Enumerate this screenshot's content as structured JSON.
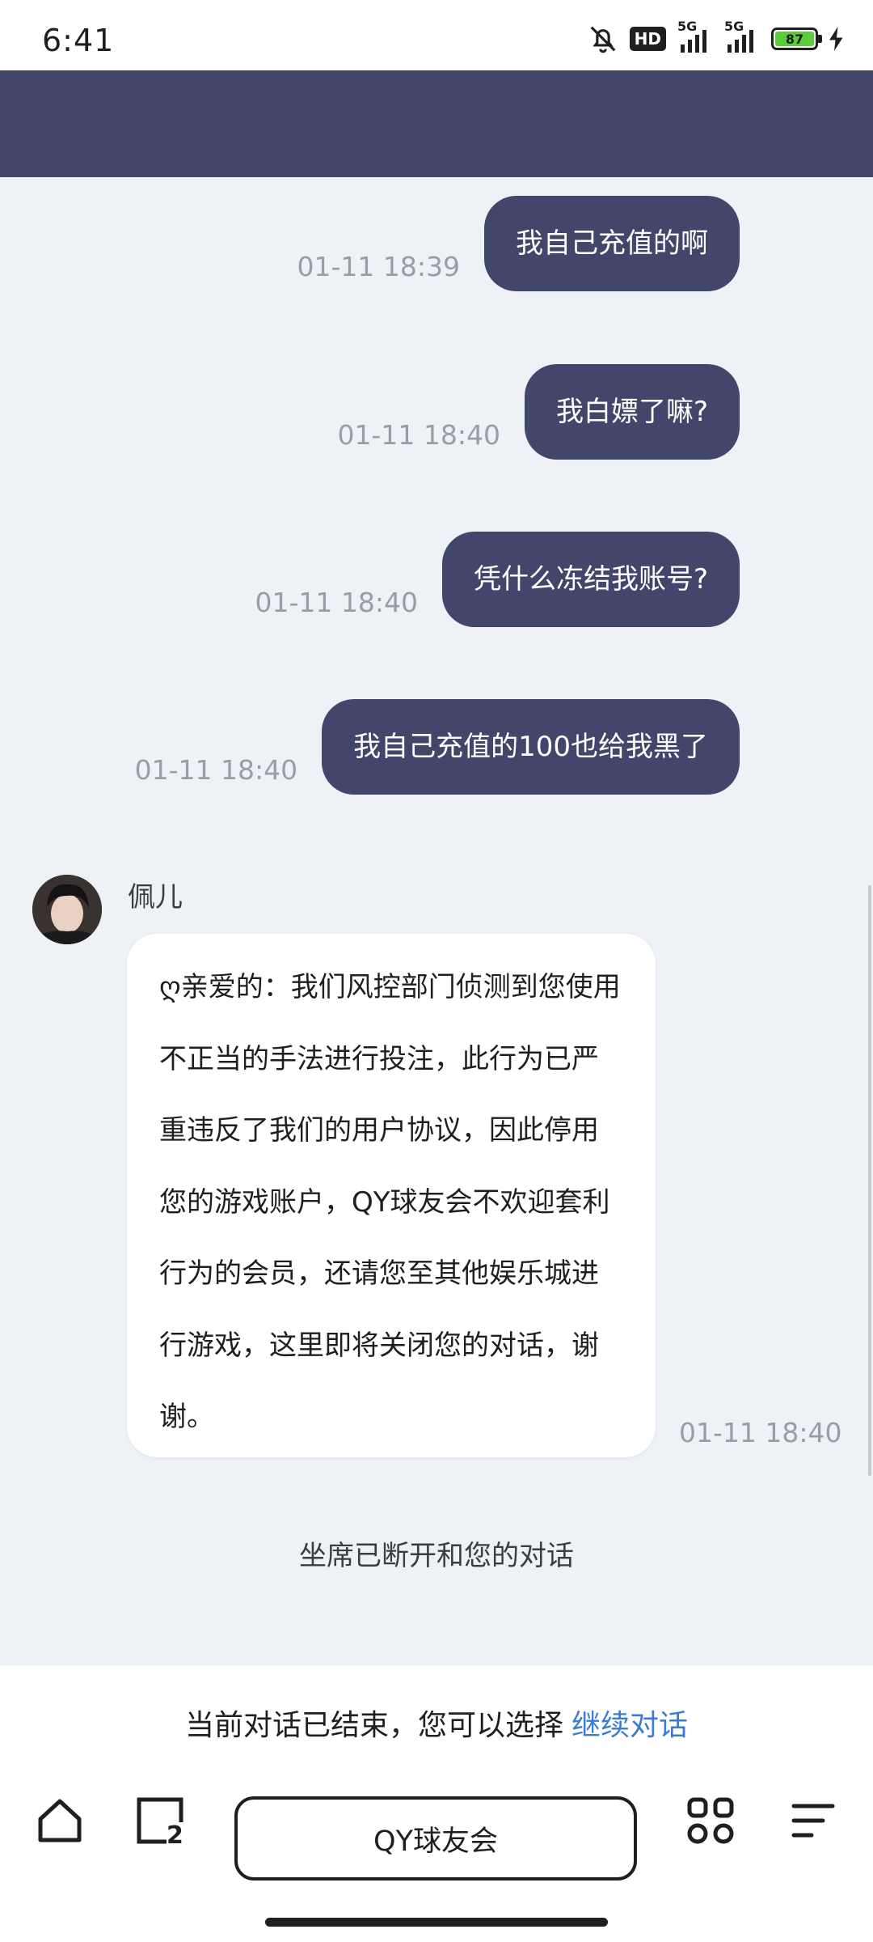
{
  "status_bar": {
    "time": "6:41",
    "hd_label": "HD",
    "signal_1_label": "5G",
    "signal_2_label": "5G",
    "battery_level": "87",
    "battery_color": "#5ccb3c",
    "icons": [
      "bell-off-icon",
      "hd-icon",
      "signal-icon",
      "signal-icon",
      "battery-icon",
      "charging-icon"
    ]
  },
  "header": {
    "color": "#43466b"
  },
  "messages": [
    {
      "type": "outgoing",
      "text": "我自己充值的啊",
      "time": "01-11 18:39"
    },
    {
      "type": "outgoing",
      "text": "我白嫖了嘛?",
      "time": "01-11 18:40"
    },
    {
      "type": "outgoing",
      "text": "凭什么冻结我账号?",
      "time": "01-11 18:40"
    },
    {
      "type": "outgoing",
      "text": "我自己充值的100也给我黑了",
      "time": "01-11 18:40"
    },
    {
      "type": "incoming",
      "sender": "佩儿",
      "text": "ღ亲爱的：我们风控部门侦测到您使用不正当的手法进行投注，此行为已严重违反了我们的用户协议，因此停用您的游戏账户，QY球友会不欢迎套利行为的会员，还请您至其他娱乐城进行游戏，这里即将关闭您的对话，谢谢。",
      "time": "01-11 18:40"
    }
  ],
  "system_notice": "坐席已断开和您的对话",
  "end_panel": {
    "notice": "当前对话已结束，您可以选择",
    "continue_link": "继续对话",
    "link_color": "#3a7bd5"
  },
  "browser_bar": {
    "url_label": "QY球友会",
    "tab_count": "2",
    "icons": [
      "home-icon",
      "tabs-icon",
      "apps-icon",
      "menu-icon"
    ]
  }
}
